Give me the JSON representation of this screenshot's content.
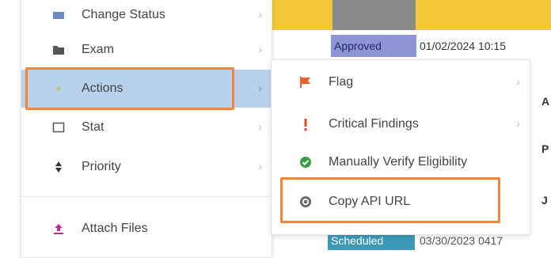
{
  "background": {
    "top_bar_color": "#f2c83a",
    "row1": {
      "badge": "Approved",
      "timestamp": "01/02/2024 10:15"
    },
    "row2": {
      "badge": "Scheduled",
      "timestamp": "03/30/2023 0417"
    },
    "edge_letters": [
      "A",
      "P",
      "J"
    ]
  },
  "main_menu": {
    "items": [
      {
        "id": "change-status",
        "label": "Change Status",
        "icon": "status-icon",
        "has_submenu": true
      },
      {
        "id": "exam",
        "label": "Exam",
        "icon": "folder-icon",
        "has_submenu": true
      },
      {
        "id": "actions",
        "label": "Actions",
        "icon": "actions-icon",
        "has_submenu": true,
        "active": true
      },
      {
        "id": "stat",
        "label": "Stat",
        "icon": "checkbox-icon",
        "has_submenu": true
      },
      {
        "id": "priority",
        "label": "Priority",
        "icon": "sort-icon",
        "has_submenu": true
      },
      {
        "id": "attach-files",
        "label": "Attach Files",
        "icon": "upload-icon",
        "has_submenu": false
      }
    ]
  },
  "submenu": {
    "items": [
      {
        "id": "flag",
        "label": "Flag",
        "icon": "flag-icon",
        "has_submenu": true
      },
      {
        "id": "critical-findings",
        "label": "Critical Findings",
        "icon": "exclamation-icon",
        "has_submenu": true
      },
      {
        "id": "verify-eligibility",
        "label": "Manually Verify Eligibility",
        "icon": "check-circle-icon",
        "has_submenu": false
      },
      {
        "id": "copy-api-url",
        "label": "Copy API URL",
        "icon": "link-circle-icon",
        "has_submenu": false
      }
    ]
  },
  "colors": {
    "highlight": "#f0873a",
    "active_item_bg": "#b8d2ee",
    "flag": "#e8632a",
    "exclamation": "#e24a2a",
    "check": "#3a9a4a",
    "upload": "#c02aa0"
  }
}
